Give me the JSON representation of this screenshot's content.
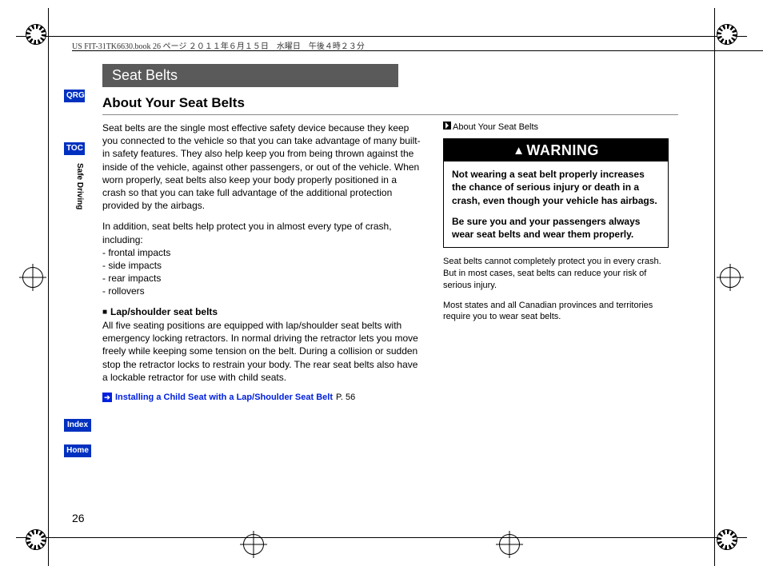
{
  "bookinfo": "US FIT-31TK6630.book  26 ページ  ２０１１年６月１５日　水曜日　午後４時２３分",
  "chapter": "Seat Belts",
  "section_title": "About Your Seat Belts",
  "left": {
    "intro": "Seat belts are the single most effective safety device because they keep you connected to the vehicle so that you can take advantage of many built-in safety features. They also help keep you from being thrown against the inside of the vehicle, against other passengers, or out of the vehicle. When worn properly, seat belts also keep your body properly positioned in a crash so that you can take full advantage of the additional protection provided by the airbags.",
    "addition_lead": "In addition, seat belts help protect you in almost every type of crash, including:",
    "impacts": [
      "- frontal impacts",
      "- side impacts",
      "- rear impacts",
      "- rollovers"
    ],
    "sub_head": "Lap/shoulder seat belts",
    "sub_body": "All five seating positions are equipped with lap/shoulder seat belts with emergency locking retractors. In normal driving the retractor lets you move freely while keeping some tension on the belt. During a collision or sudden stop the retractor locks to restrain your body. The rear seat belts also have a lockable retractor for use with child seats.",
    "link_text": "Installing a Child Seat with a Lap/Shoulder Seat Belt",
    "link_page": "P. 56"
  },
  "right": {
    "ref": "About Your Seat Belts",
    "warning_label": "WARNING",
    "warning_p1": "Not wearing a seat belt properly increases the chance of serious injury or death in a crash, even though your vehicle has airbags.",
    "warning_p2": "Be sure you and your passengers always wear seat belts and wear them properly.",
    "note1": "Seat belts cannot completely protect you in every crash. But in most cases, seat belts can reduce your risk of serious injury.",
    "note2": "Most states and all Canadian provinces and territories require you to wear seat belts."
  },
  "nav": {
    "qrg": "QRG",
    "toc": "TOC",
    "safe": "Safe Driving",
    "index": "Index",
    "home": "Home"
  },
  "page_number": "26"
}
